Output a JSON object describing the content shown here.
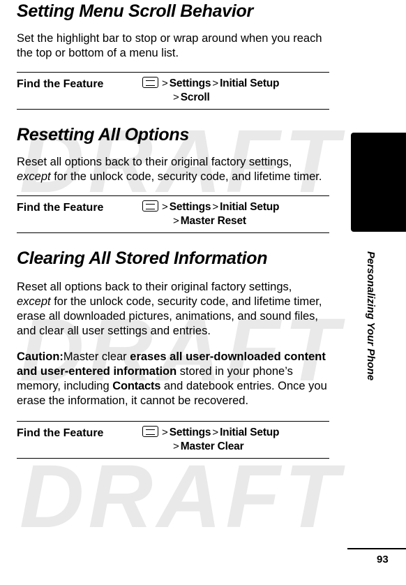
{
  "page": {
    "number": "93",
    "rail_label": "Personalizing Your Phone",
    "watermark": "DRAFT"
  },
  "sections": [
    {
      "title": "Setting Menu Scroll Behavior",
      "paragraphs": [
        "Set the highlight bar to stop or wrap around when you reach the top or bottom of a menu list."
      ],
      "find_feature": {
        "label": "Find the Feature",
        "key_icon": "menu-key-icon",
        "line1": [
          "Settings",
          "Initial Setup"
        ],
        "line2": [
          "Scroll"
        ]
      }
    },
    {
      "title": "Resetting All Options",
      "paragraphs": [
        "Reset all options back to their original factory settings, except for the unlock code, security code, and lifetime timer."
      ],
      "find_feature": {
        "label": "Find the Feature",
        "key_icon": "menu-key-icon",
        "line1": [
          "Settings",
          "Initial Setup"
        ],
        "line2": [
          "Master Reset"
        ]
      }
    },
    {
      "title": "Clearing All Stored Information",
      "paragraphs": [
        "Reset all options back to their original factory settings, except for the unlock code, security code, and lifetime timer, erase all downloaded pictures, animations, and sound files, and clear all user settings and entries."
      ],
      "caution": {
        "lead": "Caution:",
        "text_1": "Master clear ",
        "bold_1": "erases all user-downloaded content and user-entered information",
        "text_2": " stored in your phone’s memory, including ",
        "menu_1": "Contacts",
        "text_3": " and datebook entries. Once you erase the information, it cannot be recovered."
      },
      "find_feature": {
        "label": "Find the Feature",
        "key_icon": "menu-key-icon",
        "line1": [
          "Settings",
          "Initial Setup"
        ],
        "line2": [
          "Master Clear"
        ]
      }
    }
  ],
  "icons": {
    "bell": "bell-alert-icon"
  }
}
